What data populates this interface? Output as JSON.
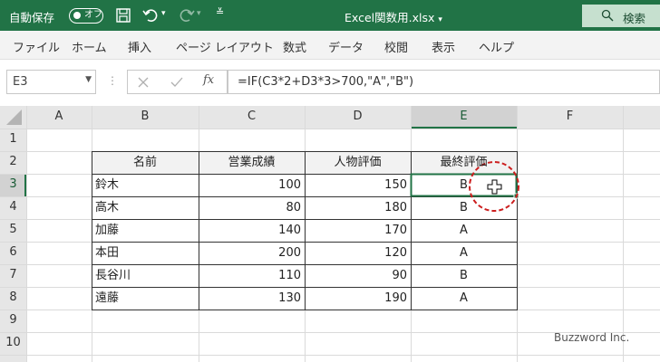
{
  "titlebar": {
    "autosave_label": "自動保存",
    "toggle_state": "オフ",
    "filename": "Excel関数用.xlsx",
    "search_label": "検索",
    "bg_color": "#217346"
  },
  "menu": {
    "items": [
      "ファイル",
      "ホーム",
      "挿入",
      "ページ レイアウト",
      "数式",
      "データ",
      "校閲",
      "表示",
      "ヘルプ"
    ]
  },
  "formula_bar": {
    "name_box": "E3",
    "formula": "=IF(C3*2+D3*3>700,\"A\",\"B\")"
  },
  "sheet": {
    "columns": [
      "A",
      "B",
      "C",
      "D",
      "E",
      "F"
    ],
    "rows": [
      "1",
      "2",
      "3",
      "4",
      "5",
      "6",
      "7",
      "8",
      "9",
      "10"
    ],
    "selected_cell": "E3",
    "table": {
      "headers": [
        "名前",
        "営業成績",
        "人物評価",
        "最終評価"
      ],
      "rows": [
        [
          "鈴木",
          "100",
          "150",
          "B"
        ],
        [
          "高木",
          "80",
          "180",
          "B"
        ],
        [
          "加藤",
          "140",
          "170",
          "A"
        ],
        [
          "本田",
          "200",
          "120",
          "A"
        ],
        [
          "長谷川",
          "110",
          "90",
          "B"
        ],
        [
          "遠藤",
          "130",
          "190",
          "A"
        ]
      ]
    }
  },
  "watermark": "Buzzword Inc."
}
